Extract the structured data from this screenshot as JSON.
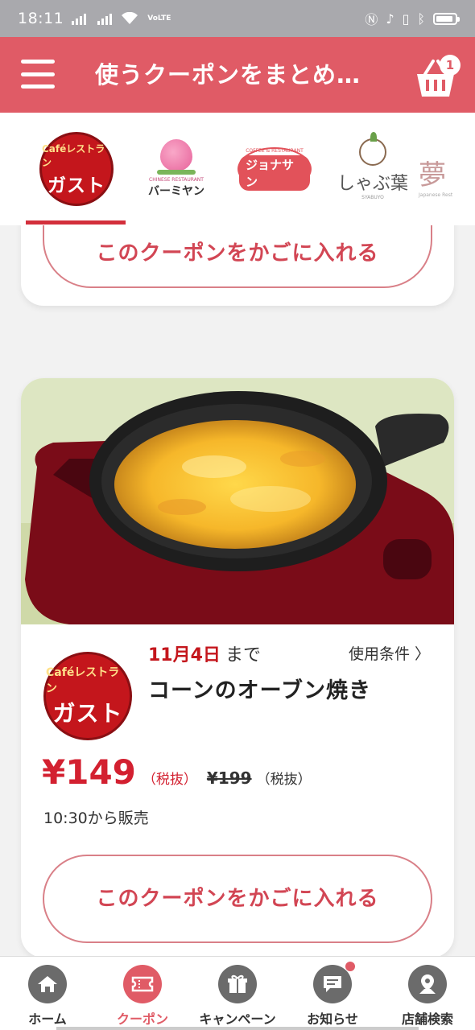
{
  "status_bar": {
    "time": "18:11",
    "network_badge": "VoLTE"
  },
  "header": {
    "title": "使うクーポンをまとめ…",
    "cart_count": "1"
  },
  "brands": [
    {
      "cafe": "Caféレストラン",
      "name": "ガスト"
    },
    {
      "sub": "CHINESE RESTAURANT",
      "name": "バーミヤン"
    },
    {
      "sub": "COFFEE & RESTAURANT",
      "name": "ジョナサン"
    },
    {
      "name": "しゃぶ葉",
      "sub": "SYABUYO"
    },
    {
      "name": "夢",
      "sub": "Japanese Rest"
    }
  ],
  "coupon_prev": {
    "add_label": "このクーポンをかごに入れる"
  },
  "coupon": {
    "brand_cafe": "Caféレストラン",
    "brand_name": "ガスト",
    "deadline_date": "11月4日",
    "deadline_suffix": "まで",
    "terms_label": "使用条件 〉",
    "item_name": "コーンのオーブン焼き",
    "price": "¥149",
    "price_tax": "（税抜）",
    "original_price": "¥199",
    "original_tax": "（税抜）",
    "sale_time": "10:30から販売",
    "add_label": "このクーポンをかごに入れる"
  },
  "nav": [
    {
      "label": "ホーム",
      "icon": "home-icon"
    },
    {
      "label": "クーポン",
      "icon": "ticket-icon"
    },
    {
      "label": "キャンペーン",
      "icon": "gift-icon"
    },
    {
      "label": "お知らせ",
      "icon": "message-icon"
    },
    {
      "label": "店舗検索",
      "icon": "map-pin-icon"
    }
  ],
  "colors": {
    "brand": "#e05b66",
    "price": "#d32030",
    "nav_inactive": "#6b6b6b"
  }
}
